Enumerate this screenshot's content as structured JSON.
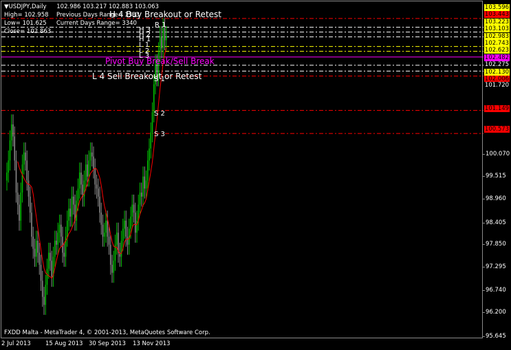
{
  "header": {
    "symbol_title": "USDJPY,Daily",
    "ohlc": "102.986 103.217 102.883 103.063",
    "high": "High= 102.958",
    "low": "Low= 101.625",
    "close": "Close= 102.863",
    "prev_days_range": "Previous Days Range= 1333",
    "current_days_range": "Current Days Range= 3340"
  },
  "footer": {
    "copyright": "FXDD Malta - MetaTrader 4, © 2001-2013, MetaQuotes Software Corp."
  },
  "annotations": {
    "h4": "H 4 Buy Breakout or Retest",
    "pivot": "Pivot Buy Break/Sell Break",
    "l4": "L 4 Sell Breakout or Retest",
    "r1": "R 1",
    "h3": "H 3",
    "h2": "H 2",
    "h1": "H 1",
    "l1": "L 1",
    "l2": "L 2",
    "l3": "L 3",
    "s1": "S 1",
    "s2": "S 2",
    "s3": "S 3"
  },
  "price_tags": [
    {
      "text": "103.596",
      "bg": "#ffff00"
    },
    {
      "text": "103.443",
      "bg": "#ff0000"
    },
    {
      "text": "103.223",
      "bg": "#ffff00"
    },
    {
      "text": "103.103",
      "bg": "#ffff00"
    },
    {
      "text": "102.983",
      "bg": "#ffff00"
    },
    {
      "text": "102.743",
      "bg": "#ffff00"
    },
    {
      "text": "102.623",
      "bg": "#ffff00"
    },
    {
      "text": "102.482",
      "bg": "#ff00ff"
    },
    {
      "text": "102.275",
      "bg": "#000000"
    },
    {
      "text": "102.130",
      "bg": "#ffff00"
    },
    {
      "text": "102.006",
      "bg": "#ff0000"
    },
    {
      "text": "101.720",
      "bg": "#000000"
    },
    {
      "text": "101.149",
      "bg": "#ff0000"
    },
    {
      "text": "100.573",
      "bg": "#ff0000"
    }
  ],
  "y_axis_labels": [
    "100.070",
    "99.515",
    "98.960",
    "98.405",
    "97.850",
    "97.295",
    "96.740",
    "96.200",
    "95.645"
  ],
  "x_axis_labels": [
    "2 Jul 2013",
    "15 Aug 2013",
    "30 Sep 2013",
    "13 Nov 2013"
  ],
  "colors": {
    "up_bar": "#00c000",
    "down_bar": "#8a8a8a",
    "ma_line": "#ff0000",
    "pivot_color": "#ff00ff",
    "red_level": "#ff0000",
    "yellow_level": "#ffff00",
    "white_level": "#ffffff"
  },
  "chart_data": {
    "type": "candlestick",
    "symbol": "USDJPY",
    "timeframe": "Daily",
    "y_range": [
      95.5,
      103.8
    ],
    "levels": [
      {
        "name": "H 4",
        "value": 103.443,
        "color": "#ff0000",
        "style": "dashdot"
      },
      {
        "name": "R 1",
        "value": 103.223,
        "color": "#ffffff",
        "style": "dashdot"
      },
      {
        "name": "H 3",
        "value": 103.103,
        "color": "#ffffff",
        "style": "dashdot"
      },
      {
        "name": "H 2",
        "value": 102.983,
        "color": "#ffffff",
        "style": "dashdot"
      },
      {
        "name": "H 1",
        "value": 102.743,
        "color": "#ffff00",
        "style": "dashdot"
      },
      {
        "name": "L 1",
        "value": 102.623,
        "color": "#ffff00",
        "style": "dashdot"
      },
      {
        "name": "Pivot",
        "value": 102.482,
        "color": "#ff00ff",
        "style": "solid"
      },
      {
        "name": "L 2",
        "value": 102.275,
        "color": "#ffffff",
        "style": "dashdot"
      },
      {
        "name": "L 3",
        "value": 102.13,
        "color": "#ffffff",
        "style": "dashdot"
      },
      {
        "name": "L 4",
        "value": 102.006,
        "color": "#ff0000",
        "style": "dashdot"
      },
      {
        "name": "S 2",
        "value": 101.149,
        "color": "#ff0000",
        "style": "dashdot"
      },
      {
        "name": "S 3",
        "value": 100.573,
        "color": "#ff0000",
        "style": "dashdot"
      }
    ],
    "closes": [
      99.6,
      99.9,
      100.4,
      100.8,
      100.5,
      99.9,
      99.1,
      98.8,
      98.4,
      99.1,
      99.8,
      100.1,
      99.9,
      99.4,
      99.0,
      98.6,
      98.0,
      97.7,
      97.5,
      97.9,
      97.6,
      97.3,
      96.9,
      96.5,
      96.3,
      96.8,
      97.2,
      97.6,
      97.4,
      97.0,
      97.5,
      97.9,
      97.8,
      98.1,
      98.3,
      98.0,
      97.6,
      97.5,
      98.0,
      98.4,
      98.7,
      98.5,
      99.0,
      98.8,
      98.4,
      98.9,
      99.2,
      99.6,
      99.3,
      99.0,
      99.4,
      99.8,
      99.5,
      99.9,
      100.1,
      100.0,
      99.7,
      99.3,
      99.2,
      99.0,
      98.6,
      98.3,
      98.0,
      98.1,
      98.4,
      98.0,
      97.8,
      97.3,
      97.1,
      97.4,
      97.8,
      98.1,
      97.6,
      97.5,
      97.9,
      98.2,
      98.4,
      98.0,
      97.8,
      98.2,
      98.5,
      98.8,
      98.6,
      98.1,
      98.4,
      98.8,
      99.1,
      99.0,
      99.5,
      99.2,
      99.4,
      99.9,
      100.2,
      100.6,
      101.1,
      101.8,
      102.3,
      102.0,
      102.6,
      103.0,
      102.7,
      103.2,
      102.9,
      103.0
    ]
  }
}
